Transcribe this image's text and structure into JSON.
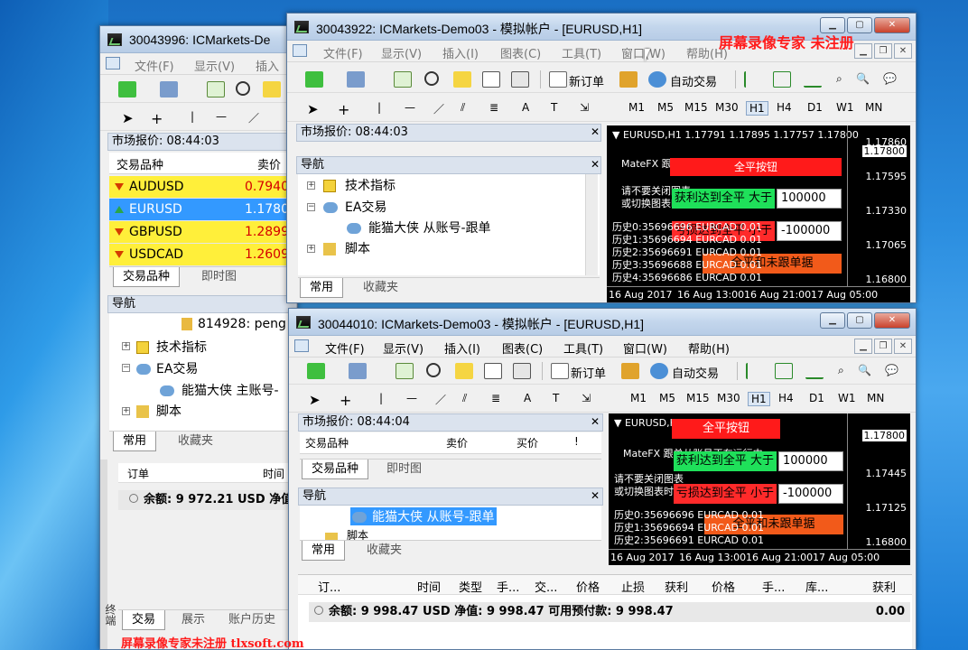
{
  "watermark_top": "屏幕录像专家 未注册",
  "watermark_bottom": "屏幕录像专家未注册 tlxsoft.com",
  "win_back": {
    "title": "30043996: ICMarkets-De",
    "menu": [
      "文件(F)",
      "显示(V)",
      "插入"
    ],
    "market_watch_title": "市场报价: 08:44:03",
    "col_symbol": "交易品种",
    "col_bid": "卖价",
    "symbols": [
      {
        "name": "AUDUSD",
        "bid": "0.79403",
        "dir": "down"
      },
      {
        "name": "EURUSD",
        "bid": "1.17800",
        "dir": "up"
      },
      {
        "name": "GBPUSD",
        "bid": "1.28992",
        "dir": "down"
      },
      {
        "name": "USDCAD",
        "bid": "1.26092",
        "dir": "down"
      }
    ],
    "tabs": [
      "交易品种",
      "即时图"
    ],
    "navigator_title": "导航",
    "nav_account": "814928: peng",
    "nav_indicators": "技术指标",
    "nav_ea": "EA交易",
    "nav_ea_item": "能猫大侠 主账号-",
    "nav_scripts": "脚本",
    "nav_tabs": [
      "常用",
      "收藏夹"
    ],
    "term_col_order": "订单",
    "term_col_time": "时间",
    "balance": "余额: 9 972.21 USD  净值",
    "term_tabs": [
      "交易",
      "展示",
      "账户历史"
    ],
    "side_label": "终端"
  },
  "win_mid": {
    "title": "30043922: ICMarkets-Demo03 - 模拟帐户 - [EURUSD,H1]",
    "menu": [
      "文件(F)",
      "显示(V)",
      "插入(I)",
      "图表(C)",
      "工具(T)",
      "窗口(W)",
      "帮助(H)"
    ],
    "new_order": "新订单",
    "auto_trade": "自动交易",
    "timeframes": [
      "M1",
      "M5",
      "M15",
      "M30",
      "H1",
      "H4",
      "D1",
      "W1",
      "MN"
    ],
    "market_watch_title": "市场报价: 08:44:03",
    "navigator_title": "导航",
    "nav_indicators": "技术指标",
    "nav_ea": "EA交易",
    "nav_ea_item": "能猫大侠 从账号-跟单",
    "nav_scripts": "脚本",
    "nav_tabs": [
      "常用",
      "收藏夹"
    ],
    "chart": {
      "title": "EURUSD,H1  1.17791 1.17895 1.17757 1.17800",
      "status_line": "MateFX 跟单从账号正在运行中",
      "hint1": "请不要关闭图表",
      "hint2": "或切换图表时间周期",
      "btn_close_all": "全平按钮",
      "profit_label": "获利达到全平 大于",
      "profit_value": "100000",
      "loss_label": "亏损达到全平 小于",
      "loss_value": "-100000",
      "close_all_unfollowed": "全平和未跟单据",
      "history": [
        "历史0:35696696 EURCAD 0.01",
        "历史1:35696694 EURCAD 0.01",
        "历史2:35696691 EURCAD 0.01",
        "历史3:35696688 EURCAD 0.01",
        "历史4:35696686 EURCAD 0.01"
      ],
      "prices": [
        "1.17860",
        "1.17800",
        "1.17595",
        "1.17330",
        "1.17065",
        "1.16800"
      ],
      "times": [
        "16 Aug 2017",
        "16 Aug 13:00",
        "16 Aug 21:00",
        "17 Aug 05:00"
      ]
    }
  },
  "win_front": {
    "title": "30044010: ICMarkets-Demo03 - 模拟帐户 - [EURUSD,H1]",
    "menu": [
      "文件(F)",
      "显示(V)",
      "插入(I)",
      "图表(C)",
      "工具(T)",
      "窗口(W)",
      "帮助(H)"
    ],
    "new_order": "新订单",
    "auto_trade": "自动交易",
    "timeframes": [
      "M1",
      "M5",
      "M15",
      "M30",
      "H1",
      "H4",
      "D1",
      "W1",
      "MN"
    ],
    "market_watch_title": "市场报价: 08:44:04",
    "col_symbol": "交易品种",
    "col_bid": "卖价",
    "col_ask": "买价",
    "mw_tabs": [
      "交易品种",
      "即时图"
    ],
    "navigator_title": "导航",
    "nav_ea_item": "能猫大侠 从账号-跟单",
    "nav_scripts": "脚本",
    "nav_tabs": [
      "常用",
      "收藏夹"
    ],
    "chart": {
      "title": "EURUSD,H1",
      "status_line": "MateFX 跟单从账号正在运行中",
      "hint1": "请不要关闭图表",
      "hint2": "或切换图表时间周期",
      "btn_close_all": "全平按钮",
      "profit_label": "获利达到全平 大于",
      "profit_value": "100000",
      "loss_label": "亏损达到全平 小于",
      "loss_value": "-100000",
      "close_all_unfollowed": "全平和未跟单据",
      "history": [
        "历史0:35696696 EURCAD 0.01",
        "历史1:35696694 EURCAD 0.01",
        "历史2:35696691 EURCAD 0.01"
      ],
      "prices": [
        "1.17800",
        "1.17445",
        "1.17125",
        "1.16800"
      ],
      "times": [
        "16 Aug 2017",
        "16 Aug 13:00",
        "16 Aug 21:00",
        "17 Aug 05:00"
      ]
    },
    "terminal_columns": [
      "订...",
      "时间",
      "类型",
      "手...",
      "交...",
      "价格",
      "止损",
      "获利",
      "价格",
      "手...",
      "库...",
      "获利"
    ],
    "balance": "余额: 9 998.47 USD  净值: 9 998.47  可用预付款: 9 998.47",
    "balance_profit": "0.00"
  }
}
